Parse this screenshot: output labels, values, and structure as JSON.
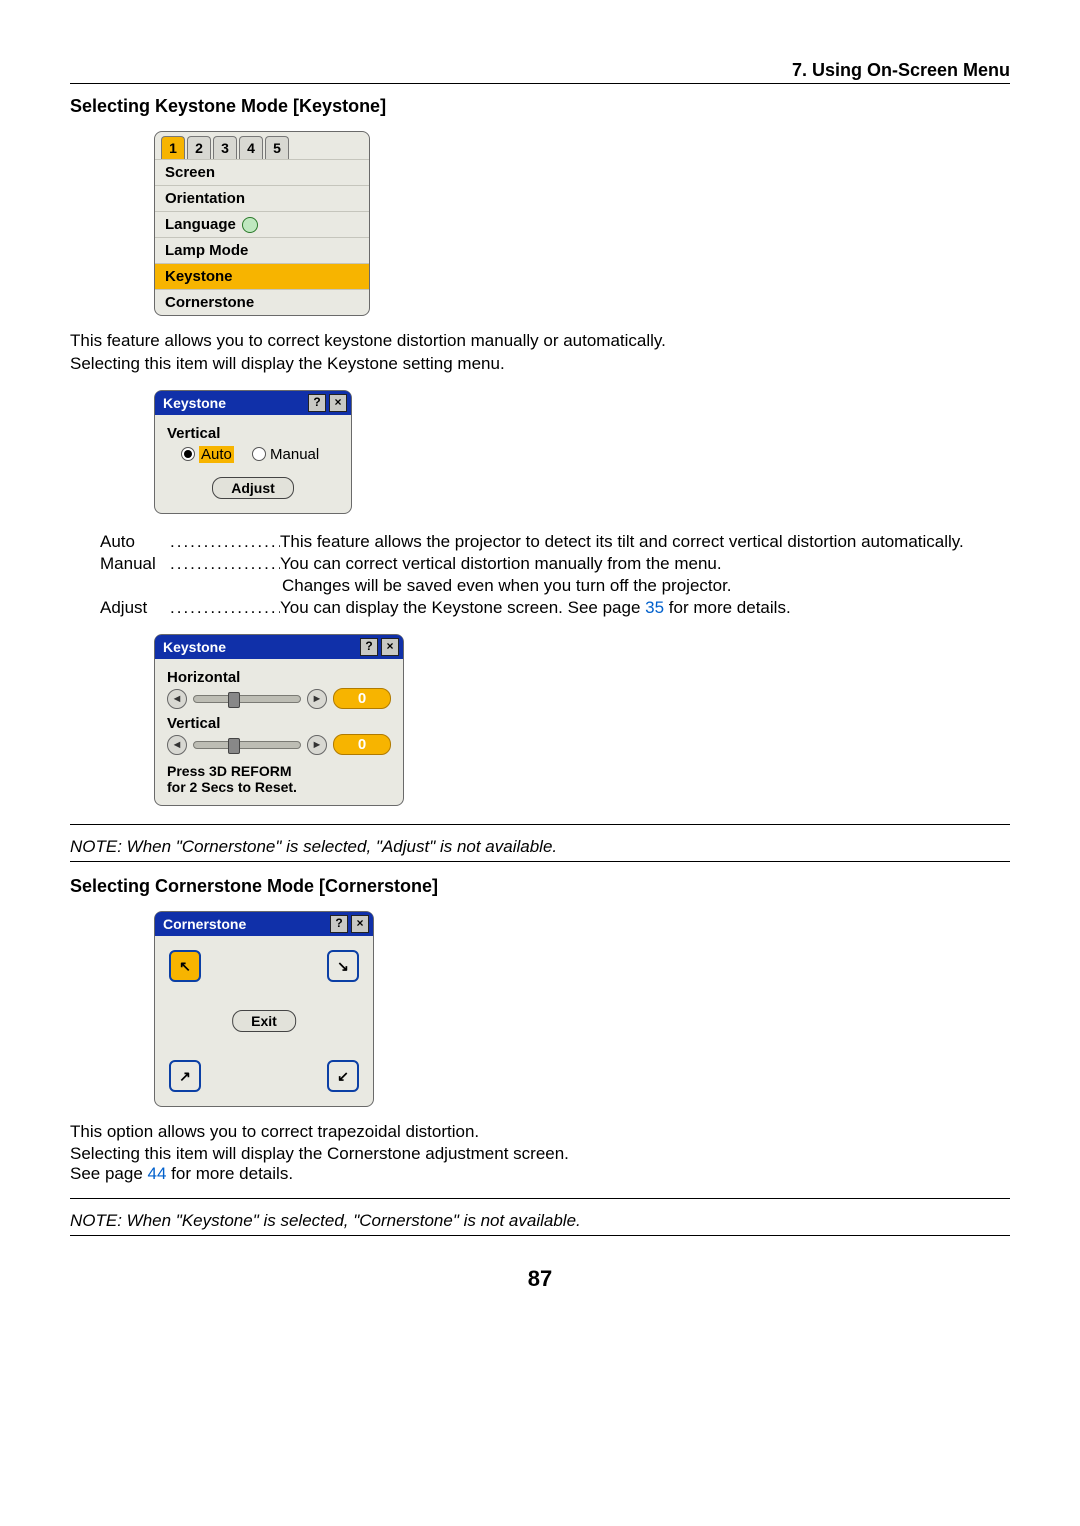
{
  "chapter": "7. Using On-Screen Menu",
  "section1": {
    "title": "Selecting Keystone Mode [Keystone]",
    "tabs": [
      "1",
      "2",
      "3",
      "4",
      "5"
    ],
    "tabs_selected": 0,
    "menu_items": [
      "Screen",
      "Orientation",
      "Language",
      "Lamp Mode",
      "Keystone",
      "Cornerstone"
    ],
    "menu_selected": 4,
    "para": "This feature allows you to correct keystone distortion manually or automatically.\nSelecting this item will display the Keystone setting menu.",
    "dialog1": {
      "title": "Keystone",
      "group_label": "Vertical",
      "opt_auto": "Auto",
      "opt_manual": "Manual",
      "adjust": "Adjust"
    },
    "defs": {
      "auto_term": "Auto",
      "auto_def": "This feature allows the projector to detect its tilt and correct vertical distortion automatically.",
      "manual_term": "Manual",
      "manual_def": "You can correct vertical distortion manually from the menu.",
      "manual_def2": "Changes will be saved even when you turn off the projector.",
      "adjust_term": "Adjust",
      "adjust_def_pre": "You can display the Keystone screen. See page ",
      "adjust_page": "35",
      "adjust_def_post": " for more details."
    },
    "dialog2": {
      "title": "Keystone",
      "h_label": "Horizontal",
      "h_value": "0",
      "v_label": "Vertical",
      "v_value": "0",
      "hint1": "Press 3D REFORM",
      "hint2": "for 2 Secs to Reset."
    },
    "note": "NOTE: When \"Cornerstone\" is selected, \"Adjust\" is not available."
  },
  "section2": {
    "title": "Selecting Cornerstone Mode [Cornerstone]",
    "dialog": {
      "title": "Cornerstone",
      "exit": "Exit"
    },
    "para1": "This option allows you to correct trapezoidal distortion.",
    "para2": "Selecting this item will display the Cornerstone adjustment screen.",
    "para3_pre": "See page ",
    "para3_page": "44",
    "para3_post": " for more details.",
    "note": "NOTE: When \"Keystone\" is selected, \"Cornerstone\" is not available."
  },
  "page_number": "87"
}
